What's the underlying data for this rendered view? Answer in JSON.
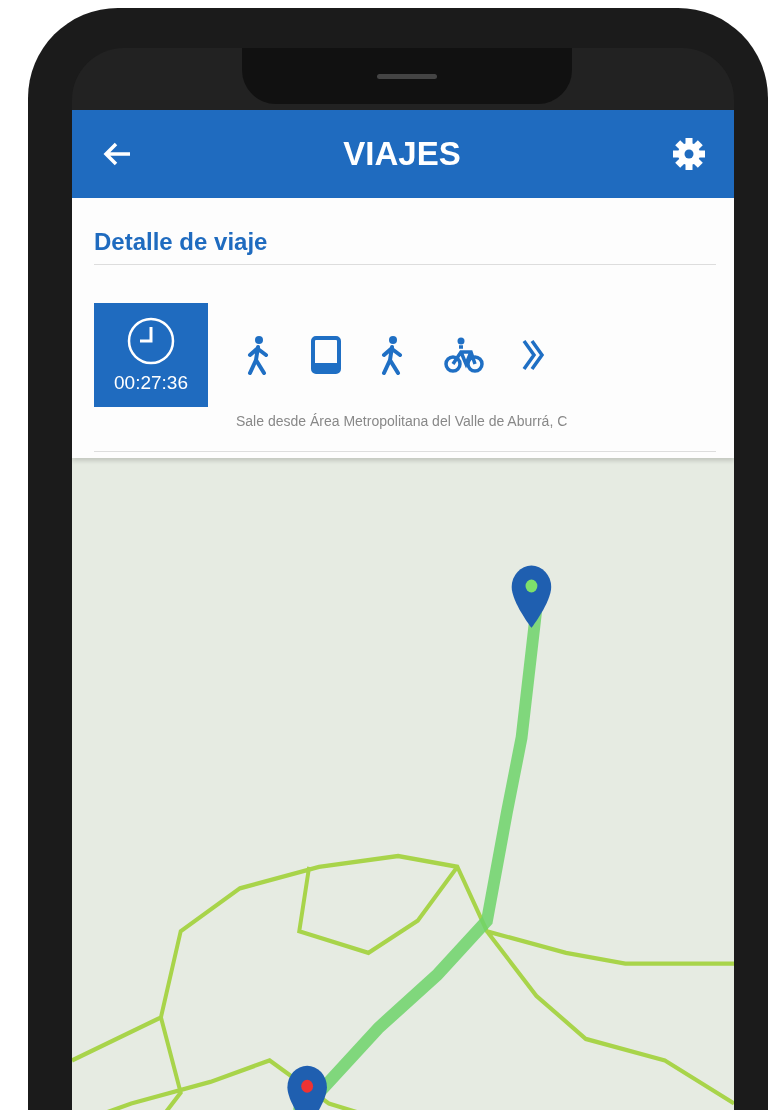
{
  "app_bar": {
    "title": "VIAJES"
  },
  "trip_detail": {
    "title": "Detalle de viaje",
    "duration": "00:27:36",
    "steps": [
      {
        "kind": "walk"
      },
      {
        "kind": "bus"
      },
      {
        "kind": "walk"
      },
      {
        "kind": "bike"
      },
      {
        "kind": "more"
      }
    ],
    "description": "Sale desde Área Metropolitana del Valle de Aburrá, C"
  }
}
